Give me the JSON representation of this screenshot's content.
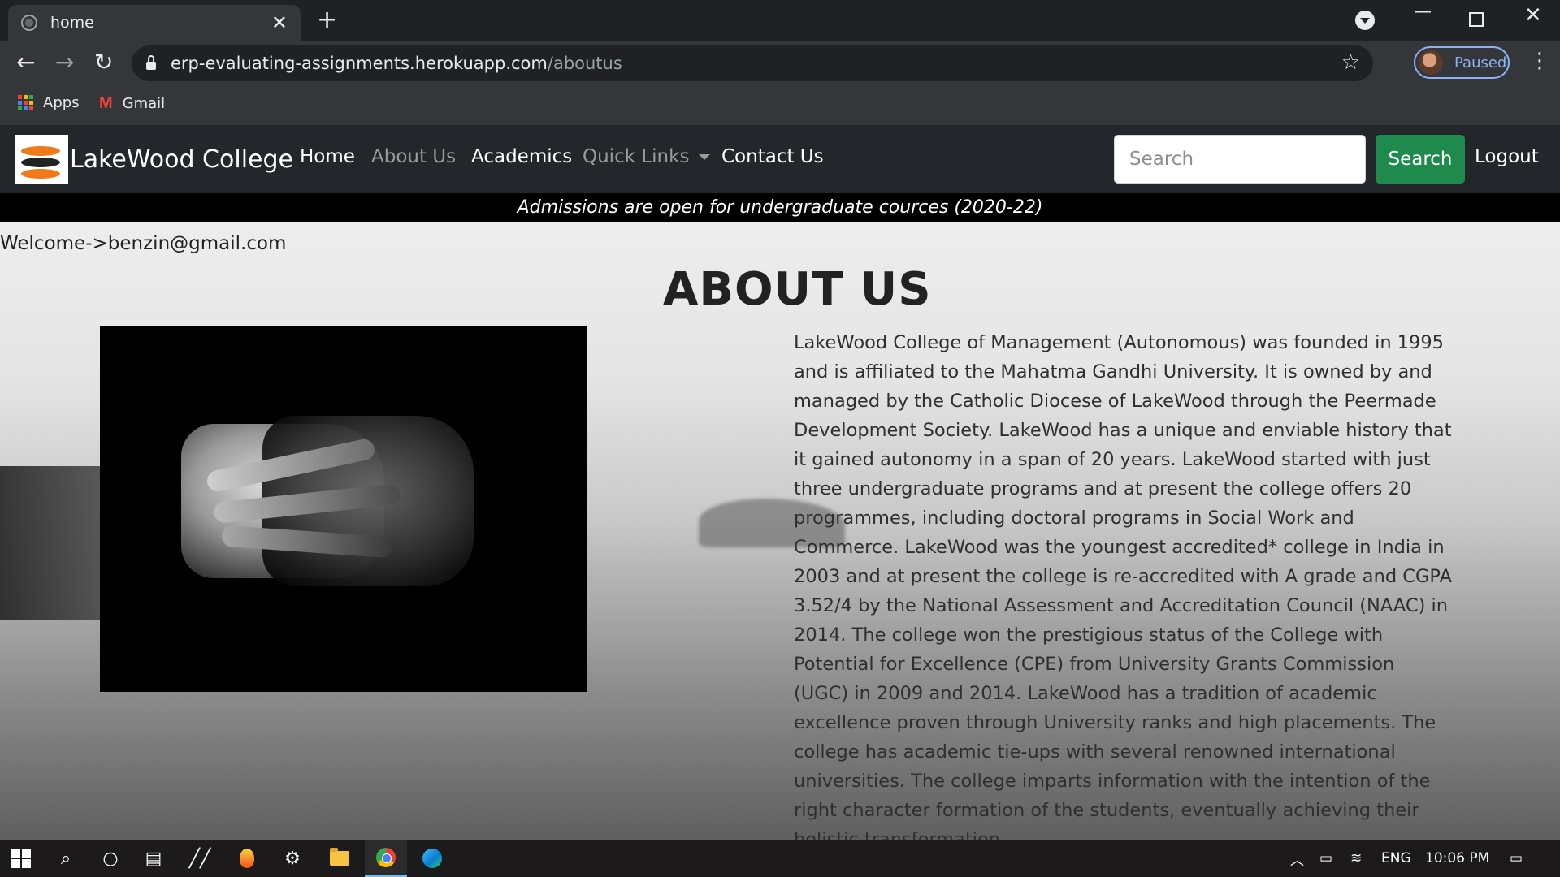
{
  "browser": {
    "tab_title": "home",
    "new_tab_symbol": "+",
    "url_host": "erp-evaluating-assignments.herokuapp.com",
    "url_path": "/aboutus",
    "profile_status": "Paused",
    "bookmarks": [
      {
        "label": "Apps",
        "icon": "apps-grid-icon"
      },
      {
        "label": "Gmail",
        "icon": "gmail-icon"
      }
    ]
  },
  "site": {
    "brand": "LakeWood College",
    "nav": {
      "home": "Home",
      "about": "About Us",
      "academics": "Academics",
      "quick_links": "Quick Links",
      "contact": "Contact Us"
    },
    "search_placeholder": "Search",
    "search_button": "Search",
    "logout": "Logout",
    "ticker": "Admissions are open for undergraduate cources (2020-22)",
    "welcome": "Welcome->benzin@gmail.com",
    "heading": "ABOUT US",
    "about_text": "LakeWood College of Management (Autonomous) was founded in 1995 and is affiliated to the Mahatma Gandhi University. It is owned by and managed by the Catholic Diocese of LakeWood through the Peermade Development Society. LakeWood has a unique and enviable history that it gained autonomy in a span of 20 years. LakeWood started with just three undergraduate programs and at present the college offers 20 programmes, including doctoral programs in Social Work and Commerce. LakeWood was the youngest accredited* college in India in 2003 and at present the college is re-accredited with A grade and CGPA 3.52/4 by the National Assessment and Accreditation Council (NAAC) in 2014. The college won the prestigious status of the College with Potential for Excellence (CPE) from University Grants Commission (UGC) in 2009 and 2014. LakeWood has a tradition of academic excellence proven through University ranks and high placements. The college has academic tie-ups with several renowned international universities. The college imparts information with the intention of the right character formation of the students, eventually achieving their holistic transformation."
  },
  "taskbar": {
    "language": "ENG",
    "time": "10:06 PM"
  },
  "colors": {
    "navbar_bg": "#23272b",
    "search_button_bg": "#1e8a4c",
    "ticker_bg": "#000000",
    "chrome_frame": "#202124"
  }
}
